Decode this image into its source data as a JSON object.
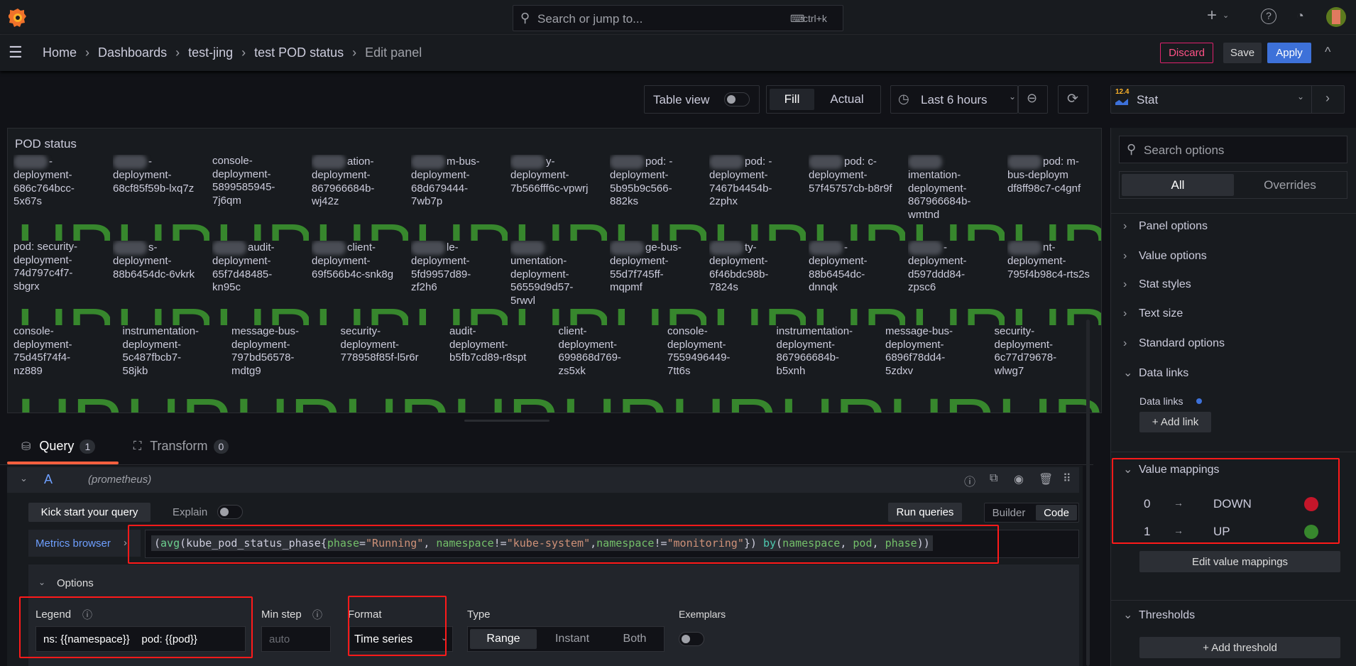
{
  "topbar": {
    "search_placeholder": "Search or jump to...",
    "shortcut": "ctrl+k",
    "new_label": "+"
  },
  "breadcrumb": [
    "Home",
    "Dashboards",
    "test-jing",
    "test POD status",
    "Edit panel"
  ],
  "actions": {
    "discard": "Discard",
    "save": "Save",
    "apply": "Apply"
  },
  "toolbar": {
    "table_view": "Table view",
    "fill": "Fill",
    "actual": "Actual",
    "time_range": "Last 6 hours"
  },
  "visualization": {
    "badge": "12.4",
    "name": "Stat"
  },
  "panel": {
    "title": "POD status",
    "value": "UP",
    "value_color": "#37872d",
    "rows": [
      [
        {
          "b": 1,
          "t": "-deployment-686c764bcc-5x67s"
        },
        {
          "b": 1,
          "t": "-deployment-68cf85f59b-lxq7z"
        },
        {
          "b": 0,
          "t": "console-deployment-5899585945-7j6qm"
        },
        {
          "b": 1,
          "t": "ation-deployment-867966684b-wj42z"
        },
        {
          "b": 1,
          "t": "m-bus-deployment-68d679444-7wb7p"
        },
        {
          "b": 1,
          "t": "y-deployment-7b566fff6c-vpwrj"
        },
        {
          "b": 1,
          "t": "pod: -deployment-5b95b9c566-882ks"
        },
        {
          "b": 1,
          "t": "pod: -deployment-7467b4454b-2zphx"
        },
        {
          "b": 1,
          "t": "pod: c-deployment-57f45757cb-b8r9f"
        },
        {
          "b": 1,
          "t": "imentation-deployment-867966684b-wmtnd"
        },
        {
          "b": 1,
          "t": "pod: m-bus-deploym df8ff98c7-c4gnf"
        }
      ],
      [
        {
          "b": 0,
          "t": "pod: security-deployment-74d797c4f7-sbgrx"
        },
        {
          "b": 1,
          "t": "s-deployment-88b6454dc-6vkrk"
        },
        {
          "b": 1,
          "t": "audit-deployment-65f7d48485-kn95c"
        },
        {
          "b": 1,
          "t": "client-deployment-69f566b4c-snk8g"
        },
        {
          "b": 1,
          "t": "le-deployment-5fd9957d89-zf2h6"
        },
        {
          "b": 1,
          "t": "umentation-deployment-56559d9d57-5rwvl"
        },
        {
          "b": 1,
          "t": "ge-bus-deployment-55d7f745ff-mqpmf"
        },
        {
          "b": 1,
          "t": "ty-deployment-6f46bdc98b-7824s"
        },
        {
          "b": 1,
          "t": "-deployment-88b6454dc-dnnqk"
        },
        {
          "b": 1,
          "t": "-deployment-d597ddd84-zpsc6"
        },
        {
          "b": 1,
          "t": "nt-deployment-795f4b98c4-rts2s"
        }
      ],
      [
        {
          "b": 0,
          "t": "console-deployment-75d45f74f4-nz889"
        },
        {
          "b": 0,
          "t": "instrumentation-deployment-5c487fbcb7-58jkb"
        },
        {
          "b": 0,
          "t": "message-bus-deployment-797bd56578-mdtg9"
        },
        {
          "b": 0,
          "t": "security-deployment-778958f85f-l5r6r"
        },
        {
          "b": 0,
          "t": "audit-deployment-b5fb7cd89-r8spt"
        },
        {
          "b": 0,
          "t": "client-deployment-699868d769-zs5xk"
        },
        {
          "b": 0,
          "t": "console-deployment-7559496449-7tt6s"
        },
        {
          "b": 0,
          "t": "instrumentation-deployment-867966684b-b5xnh"
        },
        {
          "b": 0,
          "t": "message-bus-deployment-6896f78dd4-5zdxv"
        },
        {
          "b": 0,
          "t": "security-deployment-6c77d79678-wlwg7"
        }
      ]
    ]
  },
  "tabs": [
    {
      "label": "Query",
      "count": "1"
    },
    {
      "label": "Transform",
      "count": "0"
    }
  ],
  "query": {
    "ref": "A",
    "datasource": "(prometheus)",
    "kick_start": "Kick start your query",
    "explain": "Explain",
    "run": "Run queries",
    "builder": "Builder",
    "code": "Code",
    "metrics_browser": "Metrics browser",
    "tokens": [
      [
        "(",
        "#ccccdc"
      ],
      [
        "avg",
        "#6ccf8e"
      ],
      [
        "(kube_pod_status_phase{",
        "#ccccdc"
      ],
      [
        "phase",
        "#73bf69"
      ],
      [
        "=",
        "#ccccdc"
      ],
      [
        "\"Running\"",
        "#ce9178"
      ],
      [
        ", ",
        "#ccccdc"
      ],
      [
        "namespace",
        "#73bf69"
      ],
      [
        "!=",
        "#ccccdc"
      ],
      [
        "\"kube-system\"",
        "#ce9178"
      ],
      [
        ",",
        "#ccccdc"
      ],
      [
        "namespace",
        "#73bf69"
      ],
      [
        "!=",
        "#ccccdc"
      ],
      [
        "\"monitoring\"",
        "#ce9178"
      ],
      [
        "}) ",
        "#ccccdc"
      ],
      [
        "by",
        "#4ec9b0"
      ],
      [
        "(",
        "#ccccdc"
      ],
      [
        "namespace",
        "#73bf69"
      ],
      [
        ", ",
        "#ccccdc"
      ],
      [
        "pod",
        "#73bf69"
      ],
      [
        ", ",
        "#ccccdc"
      ],
      [
        "phase",
        "#73bf69"
      ],
      [
        "))",
        "#ccccdc"
      ]
    ],
    "options": {
      "title": "Options",
      "legend_label": "Legend",
      "legend_value": "ns: {{namespace}}    pod: {{pod}}",
      "min_step_label": "Min step",
      "min_step_placeholder": "auto",
      "format_label": "Format",
      "format_value": "Time series",
      "type_label": "Type",
      "types": [
        "Range",
        "Instant",
        "Both"
      ],
      "exemplars_label": "Exemplars"
    }
  },
  "options_pane": {
    "search_placeholder": "Search options",
    "tabs": [
      "All",
      "Overrides"
    ],
    "sections": [
      "Panel options",
      "Value options",
      "Stat styles",
      "Text size",
      "Standard options"
    ],
    "data_links": {
      "title": "Data links",
      "label": "Data links",
      "add": "+ Add link"
    },
    "value_mappings": {
      "title": "Value mappings",
      "items": [
        {
          "value": "0",
          "arrow": "→",
          "text": "DOWN",
          "color": "#c4162a"
        },
        {
          "value": "1",
          "arrow": "→",
          "text": "UP",
          "color": "#37872d"
        }
      ],
      "edit": "Edit value mappings"
    },
    "thresholds": {
      "title": "Thresholds",
      "add": "+ Add threshold"
    }
  }
}
